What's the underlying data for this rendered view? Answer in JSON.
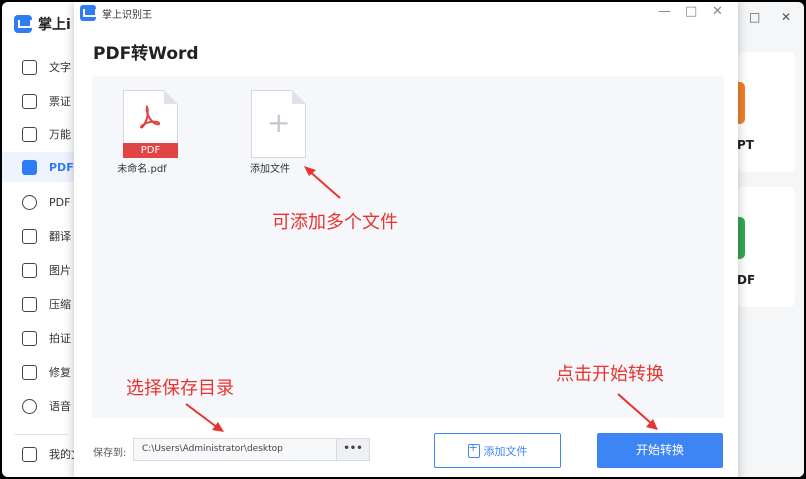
{
  "background_app": {
    "logo_text": "掌上i",
    "sidebar_items": [
      {
        "label": "文字",
        "icon": "text-icon"
      },
      {
        "label": "票证",
        "icon": "card-icon"
      },
      {
        "label": "万能",
        "icon": "scan-icon"
      },
      {
        "label": "PDF",
        "icon": "pdf-icon",
        "active": true
      },
      {
        "label": "PDF",
        "icon": "pdf-convert-icon"
      },
      {
        "label": "翻译",
        "icon": "translate-icon"
      },
      {
        "label": "图片",
        "icon": "image-icon"
      },
      {
        "label": "压缩",
        "icon": "compress-icon"
      },
      {
        "label": "拍证",
        "icon": "photo-id-icon"
      },
      {
        "label": "修复",
        "icon": "repair-icon"
      },
      {
        "label": "语音",
        "icon": "voice-icon"
      }
    ],
    "footer_item": "我的文",
    "cards": [
      {
        "label": "PT",
        "color": "#f07f2b"
      },
      {
        "label": "DF",
        "color": "#34a853"
      }
    ],
    "window_controls": [
      "□",
      "✕"
    ]
  },
  "dialog": {
    "app_title": "掌上识别王",
    "window_controls": [
      "—",
      "□",
      "✕"
    ],
    "title": "PDF转Word",
    "files": [
      {
        "name": "未命名.pdf",
        "badge": "PDF"
      }
    ],
    "add_tile_label": "添加文件",
    "save_label": "保存到:",
    "save_path": "C:\\Users\\Administrator\\desktop",
    "more_button": "•••",
    "add_file_button": "添加文件",
    "start_button": "开始转换"
  },
  "annotations": {
    "add_many": "可添加多个文件",
    "choose_dir": "选择保存目录",
    "click_start": "点击开始转换"
  },
  "colors": {
    "accent": "#3d84f5",
    "annotation": "#e8332f",
    "pdf_red": "#e04444"
  }
}
